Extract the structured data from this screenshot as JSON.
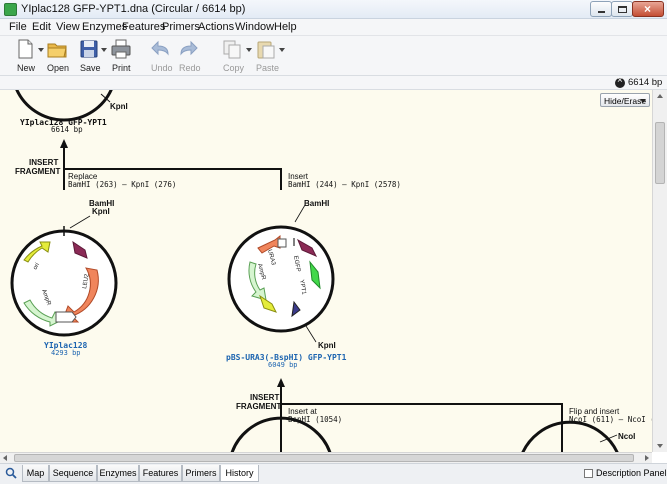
{
  "window": {
    "title": "YIplac128 GFP-YPT1.dna  (Circular / 6614 bp)"
  },
  "menu": [
    "File",
    "Edit",
    "View",
    "Enzymes",
    "Features",
    "Primers",
    "Actions",
    "Window",
    "Help"
  ],
  "toolbar": {
    "new": "New",
    "open": "Open",
    "save": "Save",
    "print": "Print",
    "undo": "Undo",
    "redo": "Redo",
    "copy": "Copy",
    "paste": "Paste"
  },
  "sequence_size": "6614 bp",
  "hide_erase": "Hide/Erase",
  "history": {
    "top_map": {
      "site": "KpnI",
      "name": "YIplac128 GFP-YPT1",
      "length": "6614 bp"
    },
    "op1": {
      "label_line1": "Insert",
      "label_line2": "Fragment",
      "left_action": "Replace",
      "left_detail": "BamHI (263) — KpnI (276)",
      "right_action": "Insert",
      "right_detail": "BamHI (244) — KpnI (2578)"
    },
    "left_map": {
      "site1": "BamHI",
      "site2": "KpnI",
      "name": "YIplac128",
      "length": "4293 bp",
      "features": {
        "ori": "ori",
        "ampr": "AmpR",
        "leu2": "LEU2"
      }
    },
    "right_map": {
      "site1": "BamHI",
      "site2": "KpnI",
      "name": "pBS-URA3(-BspHI) GFP-YPT1",
      "length": "6049 bp",
      "features": {
        "ampr": "AmpR",
        "ura3": "URA3",
        "egfp": "EGFP",
        "ypt1": "YPT1"
      }
    },
    "op2": {
      "label_line1": "Insert",
      "label_line2": "Fragment",
      "left_action": "Insert at",
      "left_detail": "BspHI (1054)",
      "right_action": "Flip and insert",
      "right_detail": "NcoI (611) — NcoI (...",
      "right_site": "NcoI"
    }
  },
  "tabs": [
    "Map",
    "Sequence",
    "Enzymes",
    "Features",
    "Primers",
    "History"
  ],
  "active_tab": "History",
  "description_panel": "Description Panel"
}
